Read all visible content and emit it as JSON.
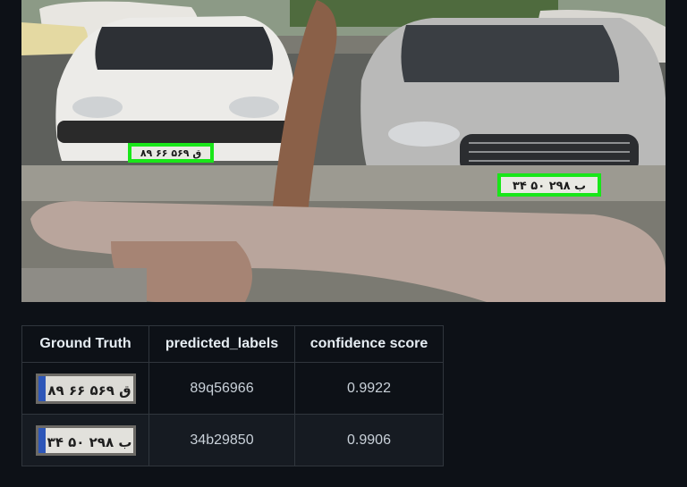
{
  "detection_image": {
    "plate_texts": [
      "۸۹ ق ۵۶۹ ۶۶",
      "۳۴ ب ۲۹۸ ۵۰"
    ],
    "box_color": "#19e619"
  },
  "results_table": {
    "headers": [
      "Ground Truth",
      "predicted_labels",
      "confidence score"
    ],
    "rows": [
      {
        "ground_truth_plate": "۸۹ ق ۵۶۹ ۶۶",
        "predicted_label": "89q56966",
        "confidence": "0.9922"
      },
      {
        "ground_truth_plate": "۳۴ ب ۲۹۸ ۵۰",
        "predicted_label": "34b29850",
        "confidence": "0.9906"
      }
    ]
  },
  "colors": {
    "page_background": "#0d1117",
    "table_border": "#30363d",
    "header_text": "#e6edf3",
    "cell_text": "#c9d1d9"
  }
}
